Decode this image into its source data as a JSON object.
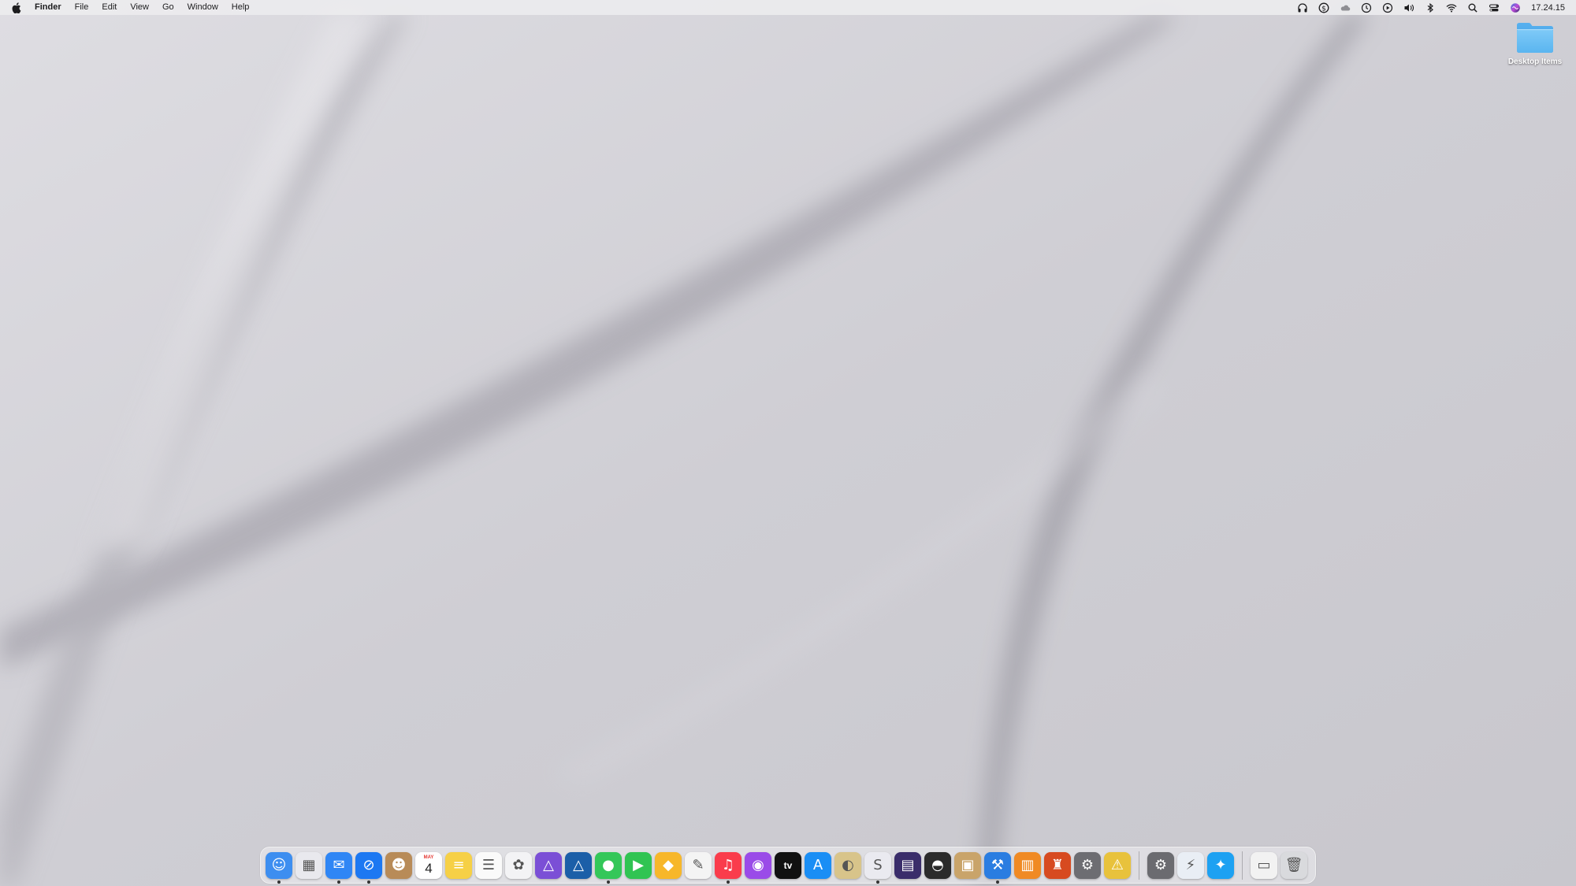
{
  "menubar": {
    "apple_icon": "apple-logo-icon",
    "items": [
      {
        "label": "Finder",
        "bold": true
      },
      {
        "label": "File"
      },
      {
        "label": "Edit"
      },
      {
        "label": "View"
      },
      {
        "label": "Go"
      },
      {
        "label": "Window"
      },
      {
        "label": "Help"
      }
    ],
    "status_icons": [
      "headphones-icon",
      "dollar-circle-icon",
      "cloud-icon",
      "time-machine-icon",
      "play-circle-icon",
      "volume-icon",
      "bluetooth-icon",
      "wifi-icon",
      "search-icon",
      "control-center-icon",
      "siri-icon"
    ],
    "clock": "17.24.15"
  },
  "desktop": {
    "items": [
      {
        "label": "Desktop Items",
        "icon": "folder-icon"
      }
    ]
  },
  "dock": {
    "apps": [
      {
        "name": "finder",
        "color": "#3d8ef0",
        "glyph": "☺",
        "running": true
      },
      {
        "name": "launchpad",
        "color": "#e9e9ee",
        "glyph": "▦",
        "running": false
      },
      {
        "name": "mail",
        "color": "#2f86f5",
        "glyph": "✉",
        "running": true
      },
      {
        "name": "safari",
        "color": "#1c78f2",
        "glyph": "⊘",
        "running": true
      },
      {
        "name": "contacts",
        "color": "#b88b58",
        "glyph": "☻",
        "running": false
      },
      {
        "name": "calendar",
        "color": "#ffffff",
        "glyph": "",
        "running": false,
        "calendar_month": "MAY",
        "calendar_day": "4"
      },
      {
        "name": "notes",
        "color": "#f6d046",
        "glyph": "≡",
        "running": false
      },
      {
        "name": "reminders",
        "color": "#fafafa",
        "glyph": "☰",
        "running": false
      },
      {
        "name": "photos",
        "color": "#f3f3f5",
        "glyph": "✿",
        "running": false
      },
      {
        "name": "affinity-photo",
        "color": "#7b4fd6",
        "glyph": "△",
        "running": false
      },
      {
        "name": "affinity-designer",
        "color": "#1b5fa8",
        "glyph": "△",
        "running": false
      },
      {
        "name": "messages",
        "color": "#34c759",
        "glyph": "●",
        "running": true
      },
      {
        "name": "facetime",
        "color": "#30c452",
        "glyph": "▶",
        "running": false
      },
      {
        "name": "sketch",
        "color": "#f7b72a",
        "glyph": "◆",
        "running": false
      },
      {
        "name": "pixelmator",
        "color": "#f4f4f4",
        "glyph": "✎",
        "running": false
      },
      {
        "name": "music",
        "color": "#fa3c4c",
        "glyph": "♫",
        "running": true
      },
      {
        "name": "podcasts",
        "color": "#9a4be8",
        "glyph": "◉",
        "running": false
      },
      {
        "name": "apple-tv",
        "color": "#111111",
        "glyph": "tv",
        "running": false
      },
      {
        "name": "app-store",
        "color": "#1a8ef5",
        "glyph": "A",
        "running": false
      },
      {
        "name": "cyberduck",
        "color": "#d8c48a",
        "glyph": "◐",
        "running": false
      },
      {
        "name": "scrivener",
        "color": "#eaeaf0",
        "glyph": "S",
        "running": true
      },
      {
        "name": "claquette",
        "color": "#3a2d6a",
        "glyph": "▤",
        "running": false
      },
      {
        "name": "alfred",
        "color": "#2b2b2b",
        "glyph": "◓",
        "running": false
      },
      {
        "name": "archive-utility",
        "color": "#c9a46a",
        "glyph": "▣",
        "running": false
      },
      {
        "name": "xcode",
        "color": "#2a7de1",
        "glyph": "⚒",
        "running": true
      },
      {
        "name": "books",
        "color": "#f08a24",
        "glyph": "▥",
        "running": false
      },
      {
        "name": "trophy-app",
        "color": "#d74a20",
        "glyph": "♜",
        "running": false
      },
      {
        "name": "system-preferences",
        "color": "#6d6d72",
        "glyph": "⚙",
        "running": false
      },
      {
        "name": "ftp-app",
        "color": "#e8c23c",
        "glyph": "⚠",
        "running": false
      }
    ],
    "extra_apps": [
      {
        "name": "network-radar",
        "color": "#6b6b70",
        "glyph": "⚙",
        "running": false
      },
      {
        "name": "spark",
        "color": "#e9eef5",
        "glyph": "⚡",
        "running": false
      },
      {
        "name": "twitter",
        "color": "#1da1f2",
        "glyph": "✦",
        "running": false
      }
    ],
    "trailing": [
      {
        "name": "downloads-stack",
        "color": "#f2f2f2",
        "glyph": "▭"
      },
      {
        "name": "trash",
        "color": "#d9dadd",
        "glyph": "🗑"
      }
    ]
  }
}
